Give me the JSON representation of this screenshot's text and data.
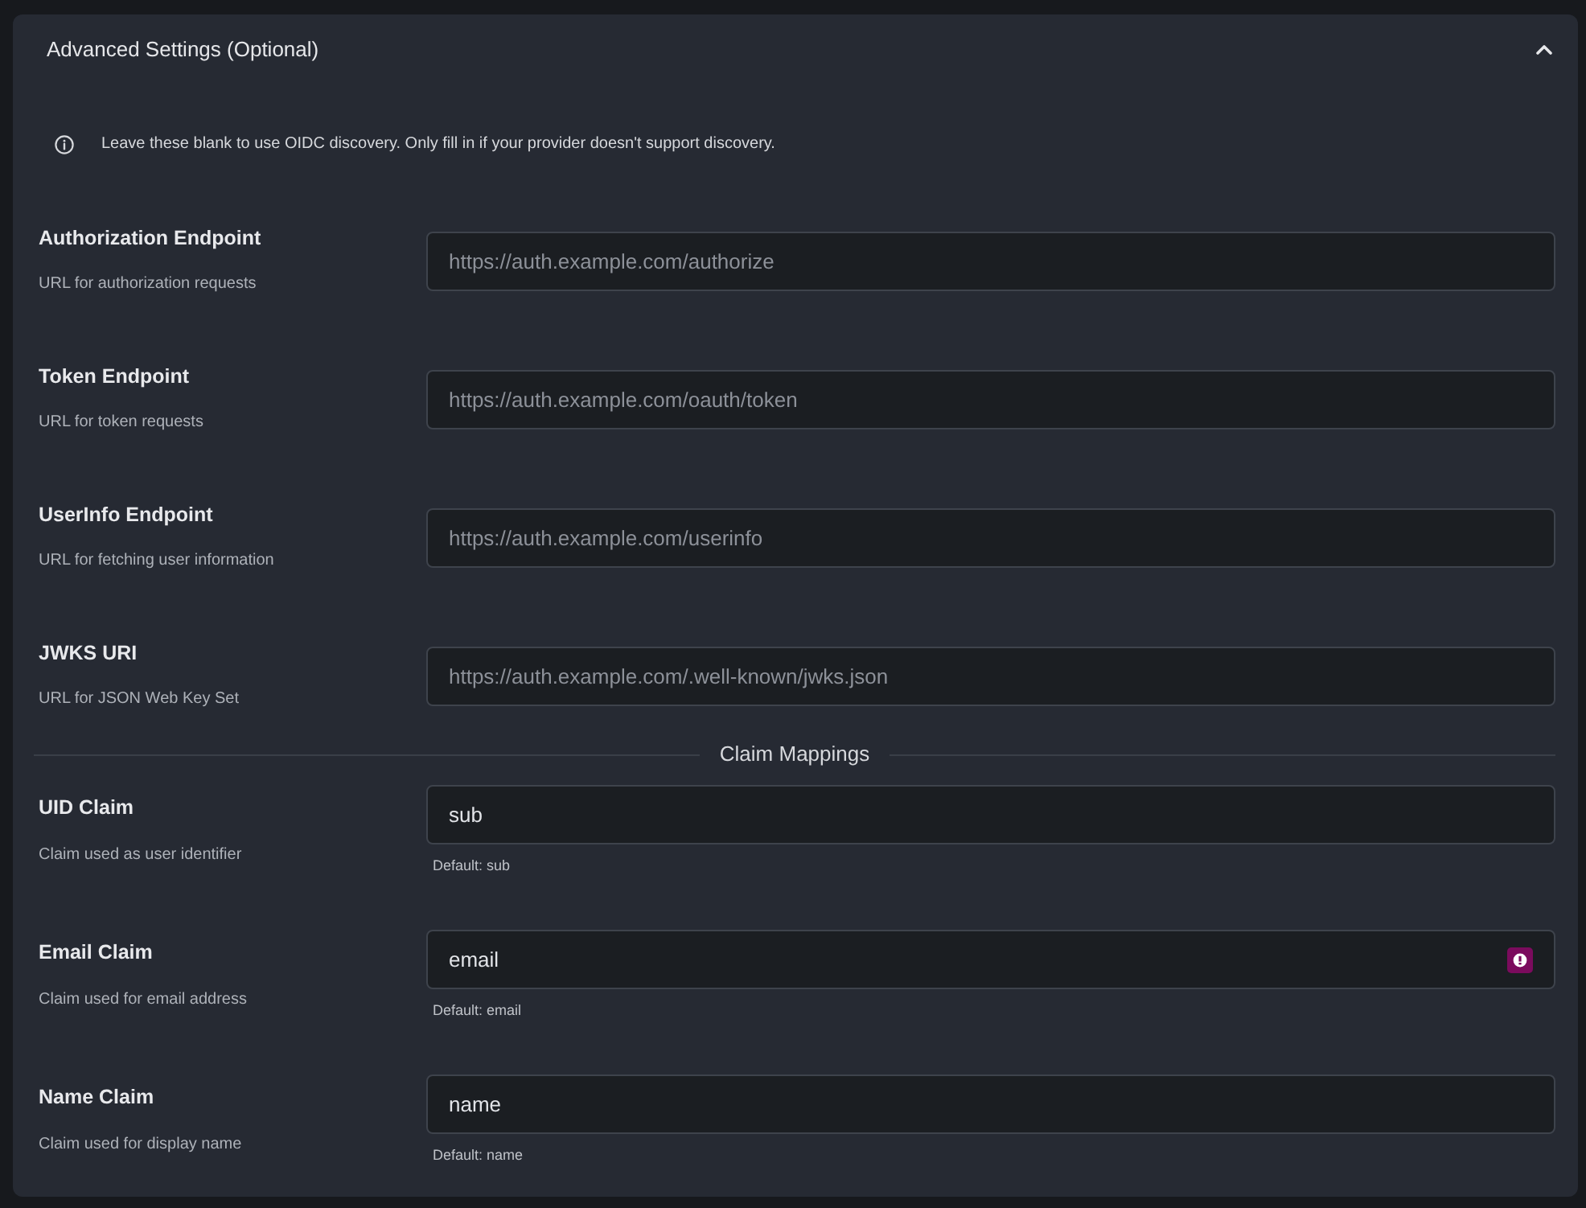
{
  "section": {
    "title": "Advanced Settings (Optional)",
    "expanded": true
  },
  "notice": {
    "text": "Leave these blank to use OIDC discovery. Only fill in if your provider doesn't support discovery."
  },
  "endpoints": [
    {
      "label": "Authorization Endpoint",
      "description": "URL for authorization requests",
      "placeholder": "https://auth.example.com/authorize"
    },
    {
      "label": "Token Endpoint",
      "description": "URL for token requests",
      "placeholder": "https://auth.example.com/oauth/token"
    },
    {
      "label": "UserInfo Endpoint",
      "description": "URL for fetching user information",
      "placeholder": "https://auth.example.com/userinfo"
    },
    {
      "label": "JWKS URI",
      "description": "URL for JSON Web Key Set",
      "placeholder": "https://auth.example.com/.well-known/jwks.json"
    }
  ],
  "divider": {
    "label": "Claim Mappings"
  },
  "claims": [
    {
      "label": "UID Claim",
      "description": "Claim used as user identifier",
      "value": "sub",
      "hint": "Default: sub",
      "badge": false
    },
    {
      "label": "Email Claim",
      "description": "Claim used for email address",
      "value": "email",
      "hint": "Default: email",
      "badge": true
    },
    {
      "label": "Name Claim",
      "description": "Claim used for display name",
      "value": "name",
      "hint": "Default: name",
      "badge": false
    }
  ]
}
